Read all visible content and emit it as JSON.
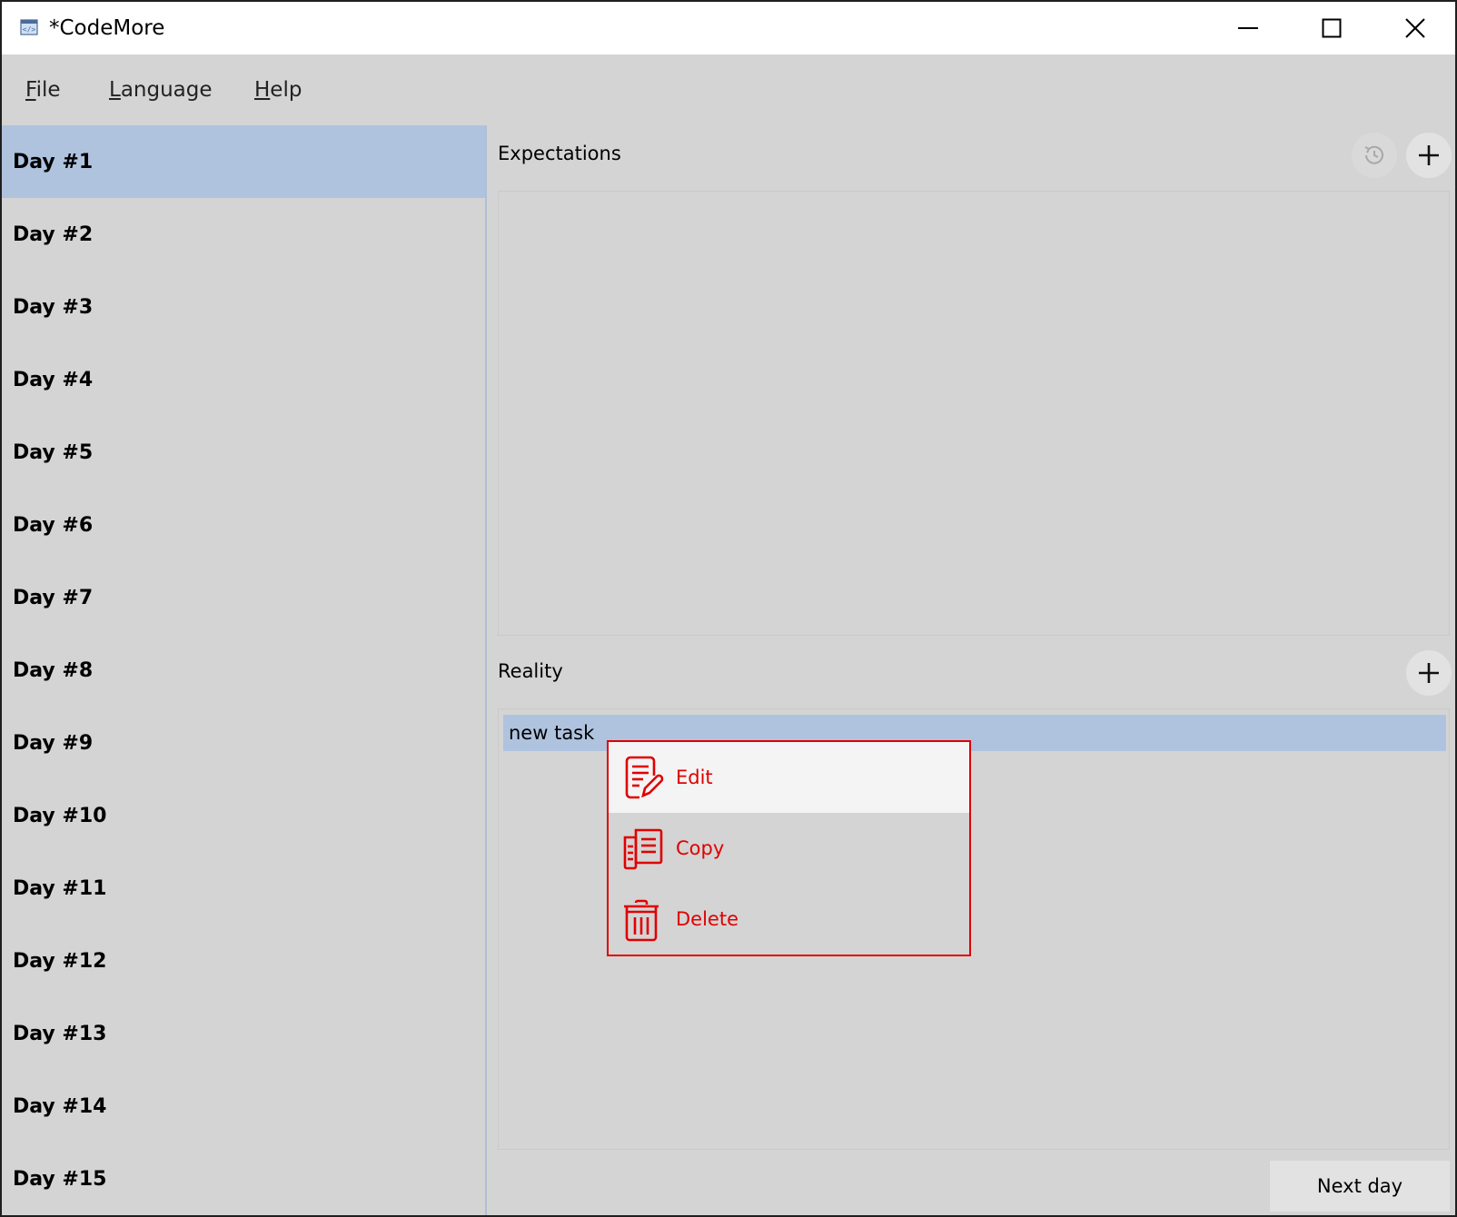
{
  "window": {
    "title": "*CodeMore"
  },
  "menu": {
    "file": "File",
    "language": "Language",
    "help": "Help"
  },
  "sidebar": {
    "days": [
      "Day #1",
      "Day #2",
      "Day #3",
      "Day #4",
      "Day #5",
      "Day #6",
      "Day #7",
      "Day #8",
      "Day #9",
      "Day #10",
      "Day #11",
      "Day #12",
      "Day #13",
      "Day #14",
      "Day #15"
    ],
    "selected_index": 0
  },
  "expectations": {
    "title": "Expectations"
  },
  "reality": {
    "title": "Reality",
    "tasks": [
      "new task"
    ]
  },
  "context_menu": {
    "edit": "Edit",
    "copy": "Copy",
    "delete": "Delete"
  },
  "footer": {
    "next_day": "Next day"
  },
  "colors": {
    "selection": "#afc3df",
    "accent_red": "#e00000",
    "background": "#d4d4d4"
  },
  "icons": {
    "history": "history-icon",
    "add": "plus-icon",
    "edit": "edit-document-icon",
    "copy": "copy-documents-icon",
    "delete": "trash-icon"
  }
}
